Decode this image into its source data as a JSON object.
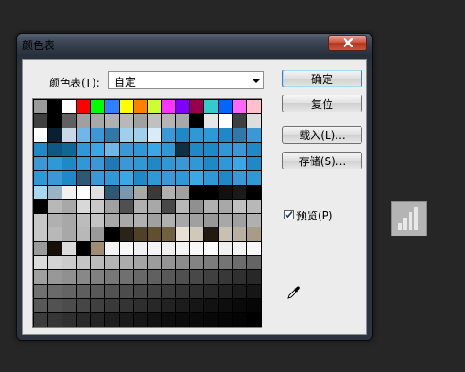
{
  "window": {
    "title": "颜色表"
  },
  "form": {
    "table_label": "颜色表(T):",
    "table_value": "自定",
    "preview_label": "预览(P)",
    "preview_checked": true
  },
  "buttons": {
    "ok": "确定",
    "reset": "复位",
    "load": "载入(L)...",
    "save": "存储(S)..."
  },
  "swatches": [
    [
      "#9a9a9a",
      "#000000",
      "#ffffff",
      "#ff0000",
      "#00ff00",
      "#2f7fff",
      "#ffff00",
      "#ff8000",
      "#ccff33",
      "#ff33ff",
      "#7f00ff",
      "#99004c",
      "#33cccc",
      "#0066ff",
      "#ff66ff",
      "#ffc0cb"
    ],
    [
      "#404040",
      "#000000",
      "#606060",
      "#a0a0a0",
      "#a8a8a8",
      "#b0b0b0",
      "#b8b8b8",
      "#a0a0a0",
      "#c0c0c0",
      "#b4b4b4",
      "#a8a8a8",
      "#000000",
      "#e6e6e6",
      "#ffffff",
      "#404040",
      "#dddddd"
    ],
    [
      "#ffffff",
      "#082030",
      "#c8d8e4",
      "#6fb7e6",
      "#3a98d6",
      "#2f78a8",
      "#9ed0ee",
      "#9ed0ee",
      "#d8ecf8",
      "#3a98d6",
      "#1f88c6",
      "#2f98d6",
      "#2f98d6",
      "#1f88c6",
      "#2f78a8",
      "#3a98d6"
    ],
    [
      "#1f88c6",
      "#0f5884",
      "#0f6894",
      "#2f98d6",
      "#3aa8e6",
      "#6fb7e6",
      "#3a98d6",
      "#2f98d6",
      "#3aa8e6",
      "#2f98d6",
      "#0f3040",
      "#1f88c6",
      "#1f88c6",
      "#2f98d6",
      "#3a98d6",
      "#1f88c6"
    ],
    [
      "#3a98d6",
      "#2f98d6",
      "#1f88c6",
      "#2f98d6",
      "#3a98d6",
      "#1f78b6",
      "#3a98d6",
      "#2f98d6",
      "#1f88c6",
      "#2f98d6",
      "#3a98d6",
      "#2f98d6",
      "#1f88c6",
      "#2f98d6",
      "#3aa8e6",
      "#1f88c6"
    ],
    [
      "#2f98d6",
      "#3a98d6",
      "#1f88c6",
      "#2f5874",
      "#3a98d6",
      "#2f98d6",
      "#3aa8e6",
      "#1f88c6",
      "#2f98d6",
      "#3a98d6",
      "#2f98d6",
      "#3aa8e6",
      "#2f98d6",
      "#1f88c6",
      "#3a98d6",
      "#2f98d6"
    ],
    [
      "#a8d8f0",
      "#9ab4c4",
      "#f0f0f0",
      "#ffffff",
      "#e0e0e0",
      "#2f5874",
      "#7898b0",
      "#a8a8a8",
      "#3a3a3a",
      "#b0b0b0",
      "#a0a0a0",
      "#000000",
      "#000000",
      "#101010",
      "#1a1a1a",
      "#000000"
    ],
    [
      "#000000",
      "#b8b8b8",
      "#a8a8a8",
      "#d8d8d8",
      "#c8c8c8",
      "#a0a0a0",
      "#505050",
      "#b0b0b0",
      "#a8a8a8",
      "#484848",
      "#b8b8b8",
      "#909090",
      "#b0b0b0",
      "#a8a8a8",
      "#c0c0c0",
      "#b8b8b8"
    ],
    [
      "#c8c8c8",
      "#b0b0b0",
      "#a8a8a8",
      "#bcbcbc",
      "#c4c4c4",
      "#a8a8a8",
      "#a8a8a8",
      "#b0b0b0",
      "#a0a0a0",
      "#b0b0b0",
      "#a8a8a8",
      "#a0a0a0",
      "#989898",
      "#a8a8a8",
      "#a0a0a0",
      "#b0b0b0"
    ],
    [
      "#c8c8c8",
      "#b8b8b8",
      "#a8a8a8",
      "#b8b8b8",
      "#9a9a9a",
      "#000000",
      "#2a2418",
      "#504028",
      "#605030",
      "#706040",
      "#e8e0d4",
      "#d0c8b8",
      "#201a10",
      "#c8c0b0",
      "#b8b0a0",
      "#a89c88"
    ],
    [
      "#9a9a9a",
      "#181008",
      "#dcdcdc",
      "#000000",
      "#a08c70",
      "#f4f4f4",
      "#f8f8f8",
      "#f0f0f0",
      "#f4f4f4",
      "#f0f0f0",
      "#f4f4f4",
      "#f8f8f8",
      "#fcfcfc",
      "#f0f0f0",
      "#f4f4f4",
      "#f8f8f8"
    ],
    [
      "#dcdcdc",
      "#d4d4d4",
      "#cccccc",
      "#c4c4c4",
      "#bcbcbc",
      "#b4b4b4",
      "#acacac",
      "#a4a4a4",
      "#9c9c9c",
      "#949494",
      "#8c8c8c",
      "#848484",
      "#7c7c7c",
      "#747474",
      "#6c6c6c",
      "#646464"
    ],
    [
      "#a0a0a0",
      "#989898",
      "#909090",
      "#888888",
      "#808080",
      "#787878",
      "#707070",
      "#686868",
      "#606060",
      "#585858",
      "#505050",
      "#484848",
      "#404040",
      "#383838",
      "#303030",
      "#282828"
    ],
    [
      "#707070",
      "#6a6a6a",
      "#646464",
      "#5e5e5e",
      "#585858",
      "#525252",
      "#4c4c4c",
      "#464646",
      "#404040",
      "#3a3a3a",
      "#343434",
      "#2e2e2e",
      "#282828",
      "#222222",
      "#1c1c1c",
      "#161616"
    ],
    [
      "#585858",
      "#525252",
      "#4c4c4c",
      "#464646",
      "#404040",
      "#3a3a3a",
      "#343434",
      "#2e2e2e",
      "#282828",
      "#222222",
      "#1c1c1c",
      "#161616",
      "#121212",
      "#0e0e0e",
      "#0a0a0a",
      "#060606"
    ],
    [
      "#3c3c3c",
      "#363636",
      "#303030",
      "#2a2a2a",
      "#242424",
      "#1e1e1e",
      "#1a1a1a",
      "#161616",
      "#121212",
      "#0e0e0e",
      "#0c0c0c",
      "#0a0a0a",
      "#080808",
      "#060606",
      "#040404",
      "#000000"
    ]
  ],
  "icons": {
    "close": "close-icon",
    "eyedropper": "eyedropper-icon",
    "checkmark": "checkmark-icon",
    "side": "bar-chart-icon"
  }
}
